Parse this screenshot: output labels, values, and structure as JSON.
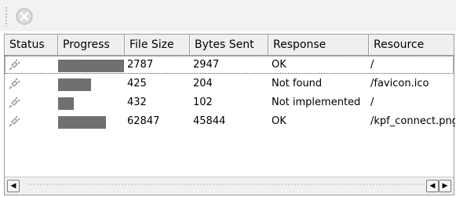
{
  "toolbar": {
    "stop_icon": "stop-icon"
  },
  "table": {
    "columns": [
      "Status",
      "Progress",
      "File Size",
      "Bytes Sent",
      "Response",
      "Resource"
    ],
    "rows": [
      {
        "status_icon": "plug-icon",
        "progress": 1.0,
        "file_size": "2787",
        "bytes_sent": "2947",
        "response": "OK",
        "resource": "/"
      },
      {
        "status_icon": "plug-icon",
        "progress": 0.5,
        "file_size": "425",
        "bytes_sent": "204",
        "response": "Not found",
        "resource": "/favicon.ico"
      },
      {
        "status_icon": "plug-icon",
        "progress": 0.24,
        "file_size": "432",
        "bytes_sent": "102",
        "response": "Not implemented",
        "resource": "/"
      },
      {
        "status_icon": "plug-icon",
        "progress": 0.73,
        "file_size": "62847",
        "bytes_sent": "45844",
        "response": "OK",
        "resource": "/kpf_connect.png"
      }
    ]
  },
  "scrollbar": {
    "left_arrow": "◀",
    "right_arrow": "▶"
  }
}
